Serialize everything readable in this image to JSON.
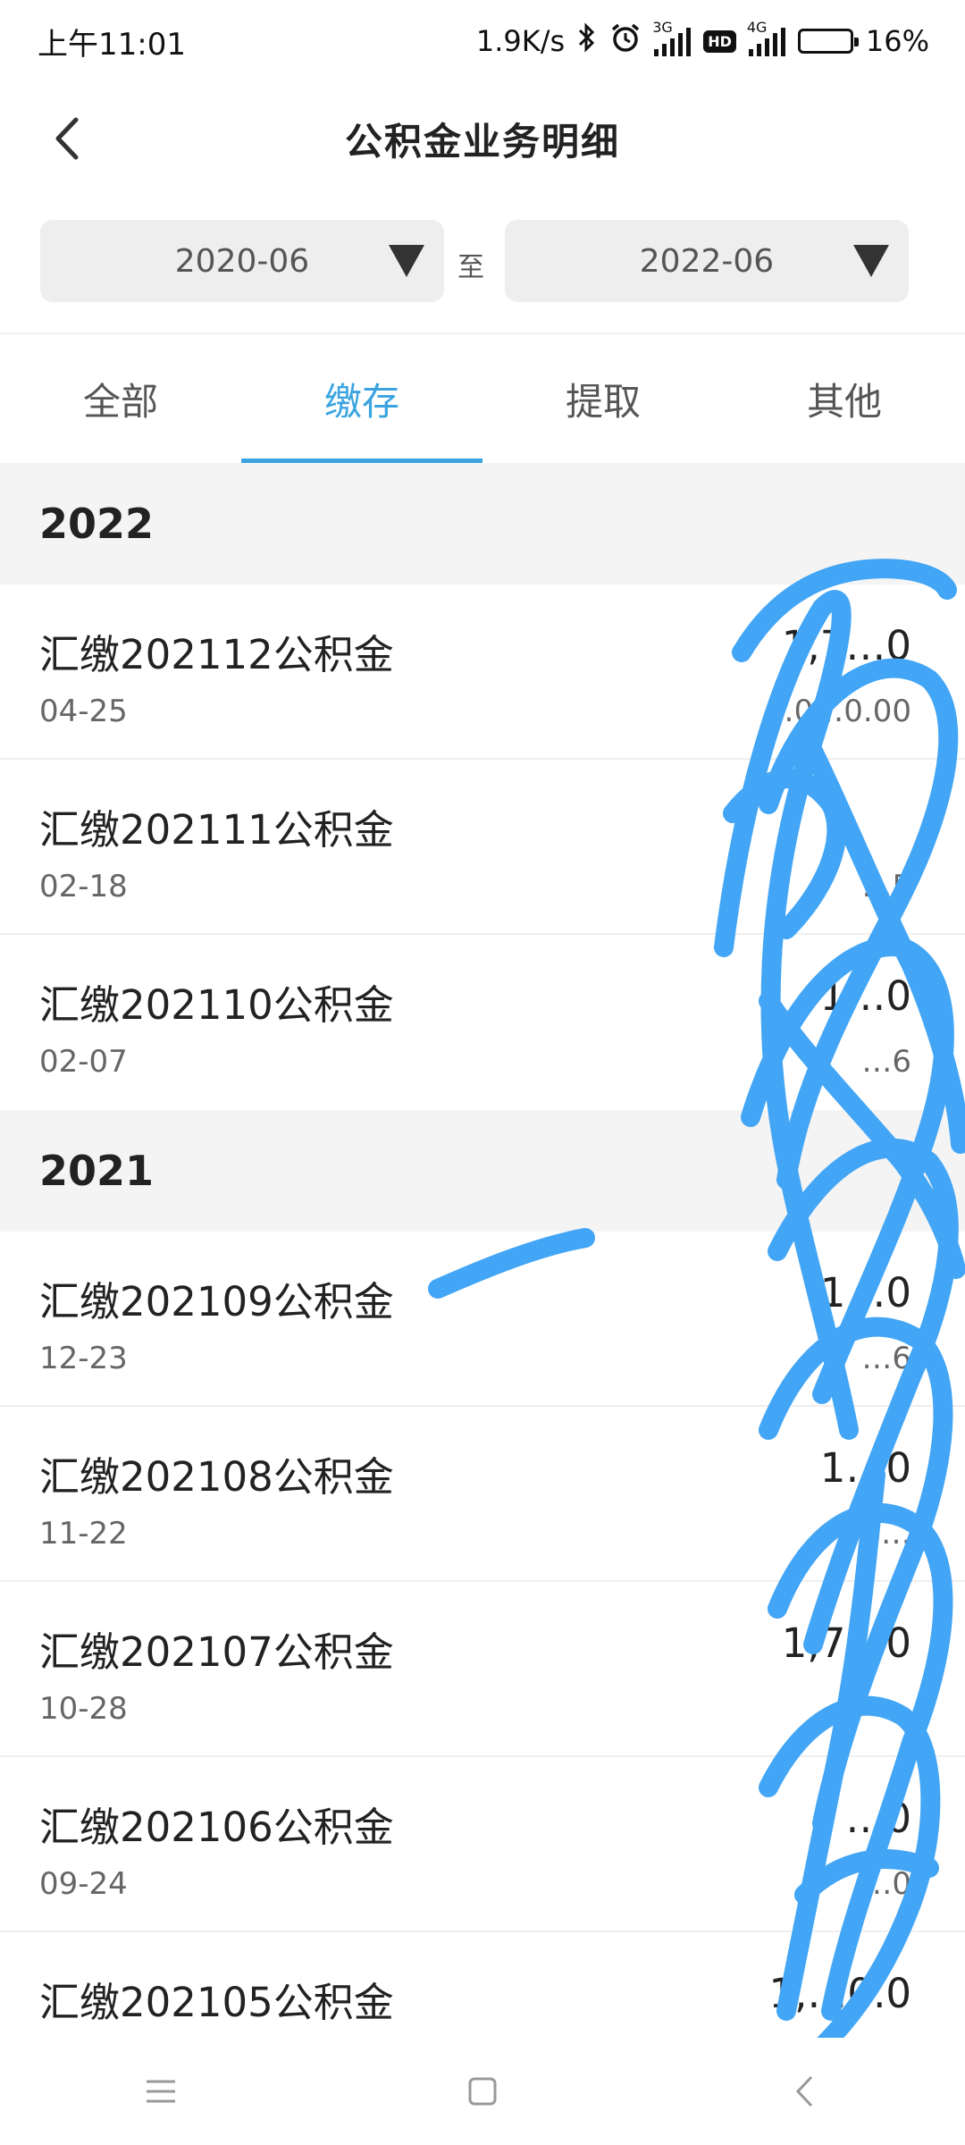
{
  "status_bar": {
    "time": "上午11:01",
    "speed": "1.9K/s",
    "net1": "3G",
    "hd": "HD",
    "net2": "4G",
    "battery": "16%",
    "battery_level": 0.16
  },
  "header": {
    "title": "公积金业务明细"
  },
  "date_range": {
    "from": "2020-06",
    "separator": "至",
    "to": "2022-06"
  },
  "tabs": [
    {
      "label": "全部"
    },
    {
      "label": "缴存"
    },
    {
      "label": "提取"
    },
    {
      "label": "其他"
    }
  ],
  "active_tab": "缴存",
  "groups": [
    {
      "year": "2022",
      "items": [
        {
          "title": "汇缴202112公积金",
          "date": "04-25",
          "amount": "1,7…0",
          "balance": "…0…0.00"
        },
        {
          "title": "汇缴202111公积金",
          "date": "02-18",
          "amount": "",
          "balance": "…5"
        },
        {
          "title": "汇缴202110公积金",
          "date": "02-07",
          "amount": "1…0",
          "balance": "…6"
        }
      ]
    },
    {
      "year": "2021",
      "items": [
        {
          "title": "汇缴202109公积金",
          "date": "12-23",
          "amount": "1…0",
          "balance": "…6"
        },
        {
          "title": "汇缴202108公积金",
          "date": "11-22",
          "amount": "1…0",
          "balance": "6…"
        },
        {
          "title": "汇缴202107公积金",
          "date": "10-28",
          "amount": "1,7…0",
          "balance": ""
        },
        {
          "title": "汇缴202106公积金",
          "date": "09-24",
          "amount": "…0",
          "balance": "…0"
        },
        {
          "title": "汇缴202105公积金",
          "date": "",
          "amount": "1,…0.0",
          "balance": ""
        }
      ]
    }
  ],
  "colors": {
    "accent": "#3ba4e0",
    "scribble": "#42a5f5"
  },
  "icons": [
    "back-arrow-icon",
    "dropdown-triangle-icon",
    "menu-icon",
    "home-icon",
    "back-icon"
  ]
}
